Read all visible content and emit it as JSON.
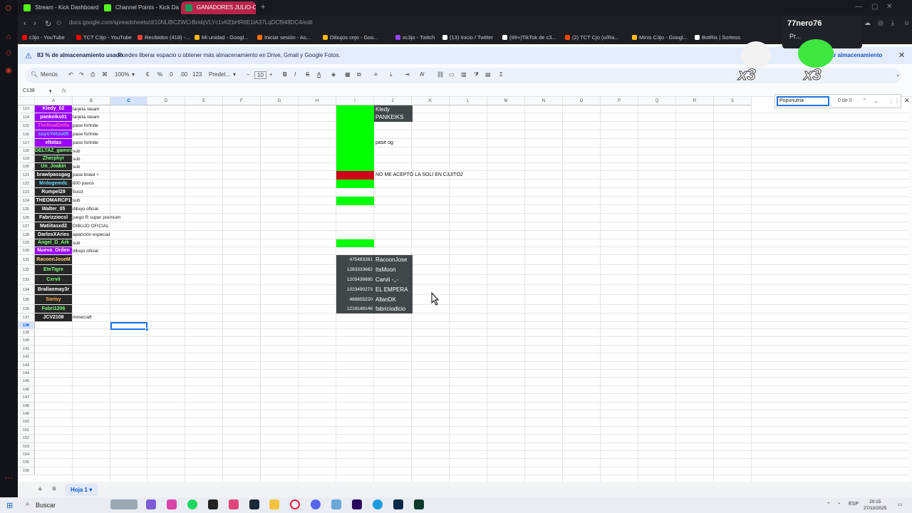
{
  "browser": {
    "tabs": [
      {
        "label": "Stream - Kick Dashboard",
        "color": "#53fc18"
      },
      {
        "label": "Channel Points - Kick Da",
        "color": "#53fc18"
      },
      {
        "label": "GANADORES JULIO-OCT",
        "color": "#0f9d58"
      }
    ],
    "url": "docs.google.com/spreadsheets/d/10NLlBCZWCrBmbjVLYc1vKEbHR6E1lA37LqDCf948DC4/edit",
    "bookmarks": [
      {
        "label": "c3jo - YouTube",
        "color": "#ff0000"
      },
      {
        "label": "TCT C3jo - YouTube",
        "color": "#ff0000"
      },
      {
        "label": "Recibidos (418) -...",
        "color": "#ea4335"
      },
      {
        "label": "Mi unidad - Googl...",
        "color": "#fbbc04"
      },
      {
        "label": "Iniciar sesión - As...",
        "color": "#ff6a00"
      },
      {
        "label": "Dibujos cejo - Goo...",
        "color": "#fbbc04"
      },
      {
        "label": "xc3jo - Twitch",
        "color": "#9146ff"
      },
      {
        "label": "(13) Inicio / Twitter",
        "color": "#ffffff"
      },
      {
        "label": "(99+)TikTok de c3...",
        "color": "#ffffff"
      },
      {
        "label": "(2) TCT Cjo (u/Ra...",
        "color": "#ff4500"
      },
      {
        "label": "Minis C3jo - Googl...",
        "color": "#fbbc04"
      },
      {
        "label": "BotRix | Sorteos",
        "color": "#ffffff"
      }
    ]
  },
  "banner": {
    "text_bold": "83 % de almacenamiento usado",
    "text": "Puedes liberar espacio u obtener más almacenamiento en Drive, Gmail y Google Fotos.",
    "action": "nar almacenamiento"
  },
  "toolbar": {
    "menus": "Menús",
    "zoom": "100%",
    "currency": "€",
    "percent": "%",
    "format123": "123",
    "font": "Predet...",
    "font_size": "10"
  },
  "formula_bar": {
    "cell_ref": "C138",
    "fx": "fx"
  },
  "find": {
    "query": "Popunutria",
    "count": "0 de 0"
  },
  "columns": [
    "A",
    "B",
    "C",
    "D",
    "E",
    "F",
    "G",
    "H",
    "I",
    "J",
    "K",
    "L",
    "M",
    "N",
    "O",
    "P",
    "Q",
    "R",
    "S"
  ],
  "rows": [
    {
      "n": "113",
      "a": "Kledy_02",
      "a_bg": "#9b00ff",
      "a_fg": "#ffffff",
      "b": "tarjeta steam",
      "i": "#00ff00",
      "j": "Kledy"
    },
    {
      "n": "114",
      "a": "pankeiks01",
      "a_bg": "#9b00ff",
      "a_fg": "#ffffff",
      "b": "tarjeta steam",
      "i": "#00ff00",
      "j": "PANKEIKS"
    },
    {
      "n": "115",
      "a": "TheRealDelfa",
      "a_bg": "#9b00ff",
      "a_fg": "#ff66aa",
      "b": "pase fortnite",
      "i": "#00ff00",
      "j": ""
    },
    {
      "n": "116",
      "a": "suyoYotsu05",
      "a_bg": "#9b00ff",
      "a_fg": "#66ccff",
      "b": "pase fortnite",
      "i": "#00ff00",
      "j": ""
    },
    {
      "n": "117",
      "a": "eltotas",
      "a_bg": "#9b00ff",
      "a_fg": "#ffffff",
      "b": "pase fortnite",
      "i": "#00ff00",
      "j": "pase og"
    },
    {
      "n": "118",
      "a": "DELTAZ_games",
      "a_bg": "#262626",
      "a_fg": "#7fff7f",
      "b": "sub",
      "i": "#00ff00",
      "j": ""
    },
    {
      "n": "119",
      "a": "Zherphyr",
      "a_bg": "#262626",
      "a_fg": "#7fff7f",
      "b": "sub",
      "i": "#00ff00",
      "j": ""
    },
    {
      "n": "120",
      "a": "Un_Joakin",
      "a_bg": "#262626",
      "a_fg": "#7fff7f",
      "b": "sub",
      "i": "#00ff00",
      "j": ""
    },
    {
      "n": "121",
      "a": "brawlpassgag",
      "a_bg": "#262626",
      "a_fg": "#ffffff",
      "b": "pase brawl +",
      "i": "#d0021b",
      "j": "NO ME ACEPTÓ LA SOLI EN C3JITO2"
    },
    {
      "n": "122",
      "a": "Mrdogemdc",
      "a_bg": "#262626",
      "a_fg": "#66d9ff",
      "b": "800 pavos",
      "i": "#00ff00",
      "j": ""
    },
    {
      "n": "123",
      "a": "Rumpel29",
      "a_bg": "#262626",
      "a_fg": "#ffffff",
      "b": "5usd",
      "i": "",
      "j": ""
    },
    {
      "n": "124",
      "a": "THEOMARCP1",
      "a_bg": "#262626",
      "a_fg": "#ffffff",
      "b": "sub",
      "i": "#00ff00",
      "j": ""
    },
    {
      "n": "125",
      "a": "Walter_05",
      "a_bg": "#262626",
      "a_fg": "#ffffff",
      "b": "dibujo oficial",
      "i": "",
      "j": ""
    },
    {
      "n": "126",
      "a": "Fabrizziocsl",
      "a_bg": "#262626",
      "a_fg": "#ffffff",
      "b": "juego R super premium",
      "i": "",
      "j": ""
    },
    {
      "n": "127",
      "a": "Matiitasxd2",
      "a_bg": "#262626",
      "a_fg": "#ffffff",
      "b": "DIBUJO OFICIAL",
      "i": "",
      "j": ""
    },
    {
      "n": "128",
      "a": "DarloxXAries",
      "a_bg": "#262626",
      "a_fg": "#ffffff",
      "b": "aparición especial",
      "i": "",
      "j": ""
    },
    {
      "n": "129",
      "a": "Angel_D_Ark",
      "a_bg": "#262626",
      "a_fg": "#7fff7f",
      "b": "sub",
      "i": "#00ff00",
      "j": ""
    },
    {
      "n": "130",
      "a": "Nueva_Orden",
      "a_bg": "#9b00ff",
      "a_fg": "#ffffff",
      "b": "dibujo oficial",
      "i": "",
      "j": ""
    },
    {
      "n": "131",
      "a": "RacoonJoseM",
      "a_bg": "#262626",
      "a_fg": "#ffd27f",
      "b": "",
      "i": "",
      "j": ""
    },
    {
      "n": "132",
      "a": "EteTigre",
      "a_bg": "#262626",
      "a_fg": "#7fff7f",
      "b": "",
      "i": "",
      "j": ""
    },
    {
      "n": "133",
      "a": "Cxrvii",
      "a_bg": "#262626",
      "a_fg": "#7fff7f",
      "b": "",
      "i": "",
      "j": ""
    },
    {
      "n": "134",
      "a": "Brallanmay3r",
      "a_bg": "#262626",
      "a_fg": "#ffffff",
      "b": "",
      "i": "",
      "j": ""
    },
    {
      "n": "135",
      "a": "Sorisy",
      "a_bg": "#262626",
      "a_fg": "#ffb347",
      "b": "",
      "i": "",
      "j": ""
    },
    {
      "n": "136",
      "a": "Fabri1206",
      "a_bg": "#262626",
      "a_fg": "#7fff7f",
      "b": "",
      "i": "",
      "j": ""
    },
    {
      "n": "137",
      "a": "JCV2108",
      "a_bg": "#262626",
      "a_fg": "#ffffff",
      "b": "minecraft",
      "i": "",
      "j": ""
    }
  ],
  "empty_rows": [
    "138",
    "139",
    "140",
    "141",
    "142",
    "143",
    "144",
    "145",
    "146",
    "147",
    "148",
    "149",
    "150",
    "151",
    "152",
    "153",
    "154",
    "155",
    "156"
  ],
  "ids_box": [
    {
      "id": "475483281",
      "name": "RacoonJose"
    },
    {
      "id": "1283333682",
      "name": "ItsMoon"
    },
    {
      "id": "1205436695",
      "name": "Carvii -,,-"
    },
    {
      "id": "1023490273",
      "name": "EL EMPERA"
    },
    {
      "id": "469855220",
      "name": "AllanDK"
    },
    {
      "id": "1219148146",
      "name": "fabriciodicio"
    }
  ],
  "sheet_tab": "Hoja 1",
  "overlay": {
    "username": "77nero76",
    "sub": "Pr...",
    "multiplier1": "x3",
    "multiplier2": "x3"
  },
  "taskbar": {
    "search": "Buscar",
    "lang": "ESP",
    "time": "20:15",
    "date": "27/10/2025"
  }
}
